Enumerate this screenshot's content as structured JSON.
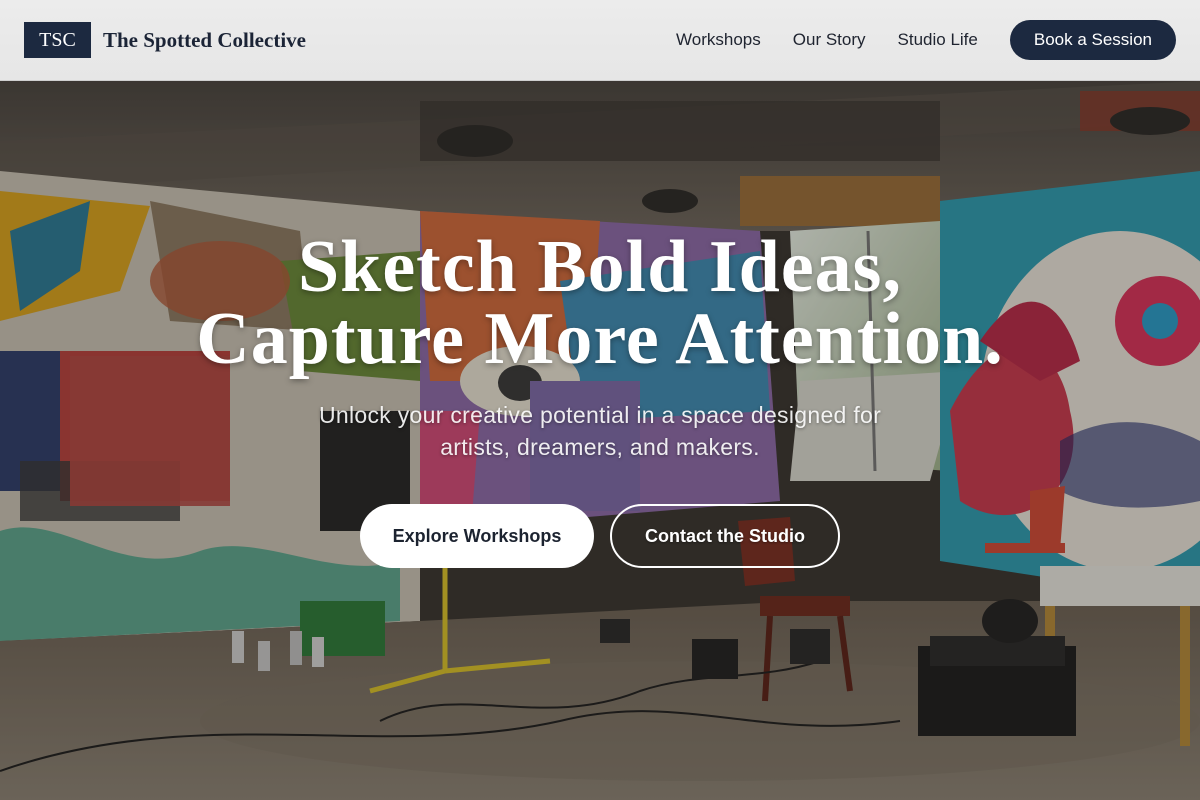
{
  "header": {
    "logo_text": "TSC",
    "brand_name": "The Spotted Collective",
    "nav": [
      {
        "label": "Workshops"
      },
      {
        "label": "Our Story"
      },
      {
        "label": "Studio Life"
      }
    ],
    "cta_label": "Book a Session"
  },
  "hero": {
    "headline_line1": "Sketch Bold Ideas,",
    "headline_line2": "Capture More Attention.",
    "subhead_line1": "Unlock your creative potential in a space designed for",
    "subhead_line2": "artists, dreamers, and makers.",
    "primary_button": "Explore Workshops",
    "secondary_button": "Contact the Studio"
  },
  "colors": {
    "brand_navy": "#1c2940",
    "header_bg": "#ececec",
    "hero_text": "#ffffff"
  }
}
